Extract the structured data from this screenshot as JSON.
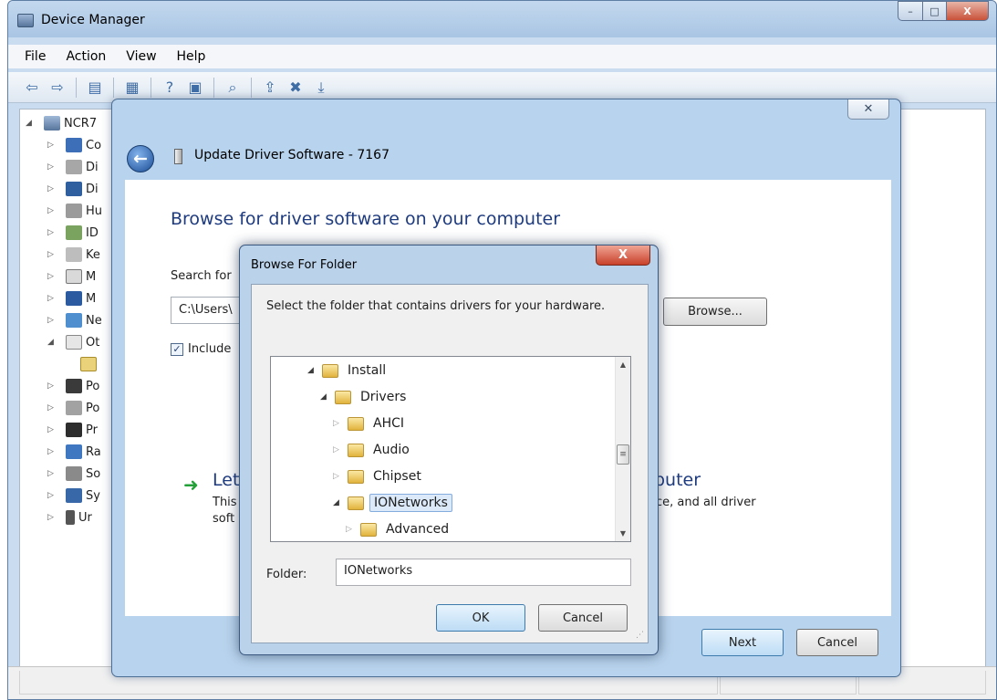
{
  "device_manager": {
    "title": "Device Manager",
    "title_icon": "device-manager-icon",
    "window_buttons": {
      "minimize": "–",
      "maximize": "□",
      "close": "X"
    },
    "menu": [
      "File",
      "Action",
      "View",
      "Help"
    ],
    "toolbar_icons": [
      "back-icon",
      "forward-icon",
      "properties-icon",
      "help-icon",
      "show-hidden-icon",
      "scan-hardware-icon",
      "update-driver-icon",
      "uninstall-icon",
      "disable-icon"
    ],
    "tree": [
      {
        "label": "NCR7",
        "expander": "◢",
        "icon": "computer-icon"
      },
      {
        "label": "Co",
        "expander": "▷",
        "icon": "computer-icon"
      },
      {
        "label": "Di",
        "expander": "▷",
        "icon": "disk-drive-icon"
      },
      {
        "label": "Di",
        "expander": "▷",
        "icon": "display-adapter-icon"
      },
      {
        "label": "Hu",
        "expander": "▷",
        "icon": "usb-hid-icon"
      },
      {
        "label": "ID",
        "expander": "▷",
        "icon": "ide-controller-icon"
      },
      {
        "label": "Ke",
        "expander": "▷",
        "icon": "keyboard-icon"
      },
      {
        "label": "M",
        "expander": "▷",
        "icon": "mouse-icon"
      },
      {
        "label": "M",
        "expander": "▷",
        "icon": "monitor-icon"
      },
      {
        "label": "Ne",
        "expander": "▷",
        "icon": "network-adapter-icon"
      },
      {
        "label": "Ot",
        "expander": "◢",
        "icon": "other-devices-icon"
      },
      {
        "label": "",
        "expander": "",
        "icon": "unknown-device-icon"
      },
      {
        "label": "Po",
        "expander": "▷",
        "icon": "port-icon"
      },
      {
        "label": "Po",
        "expander": "▷",
        "icon": "power-icon"
      },
      {
        "label": "Pr",
        "expander": "▷",
        "icon": "processor-icon"
      },
      {
        "label": "Ra",
        "expander": "▷",
        "icon": "radio-icon"
      },
      {
        "label": "So",
        "expander": "▷",
        "icon": "sound-icon"
      },
      {
        "label": "Sy",
        "expander": "▷",
        "icon": "system-device-icon"
      },
      {
        "label": "Ur",
        "expander": "▷",
        "icon": "usb-icon"
      }
    ]
  },
  "wizard": {
    "title": "Update Driver Software - 7167",
    "close_glyph": "✕",
    "back_glyph": "←",
    "heading": "Browse for driver software on your computer",
    "search_label": "Search for",
    "path_value": "C:\\Users\\",
    "browse_label": "Browse...",
    "include_label": "Include",
    "include_checked": "✓",
    "let_arrow": "➜",
    "let_text": "Let",
    "puter_text": "puter",
    "this_text": "This",
    "soft_text": "soft",
    "desc_right": "ce, and all driver",
    "next_label": "Next",
    "cancel_label": "Cancel"
  },
  "browse_folder": {
    "title": "Browse For Folder",
    "close_glyph": "X",
    "instruction": "Select the folder that contains drivers for your hardware.",
    "tree": [
      {
        "label": "Install",
        "expander": "◢",
        "indent": 2,
        "selected": false
      },
      {
        "label": "Drivers",
        "expander": "◢",
        "indent": 3,
        "selected": false
      },
      {
        "label": "AHCI",
        "expander": "▷",
        "indent": 4,
        "selected": false
      },
      {
        "label": "Audio",
        "expander": "▷",
        "indent": 4,
        "selected": false
      },
      {
        "label": "Chipset",
        "expander": "▷",
        "indent": 4,
        "selected": false
      },
      {
        "label": "IONetworks",
        "expander": "◢",
        "indent": 4,
        "selected": true
      },
      {
        "label": "Advanced",
        "expander": "▷",
        "indent": 5,
        "selected": false
      }
    ],
    "scroll_up": "▲",
    "scroll_down": "▼",
    "thumb_grip": "≡",
    "folder_label": "Folder:",
    "folder_value": "IONetworks",
    "ok_label": "OK",
    "cancel_label": "Cancel",
    "grip_glyph": "⋰"
  }
}
